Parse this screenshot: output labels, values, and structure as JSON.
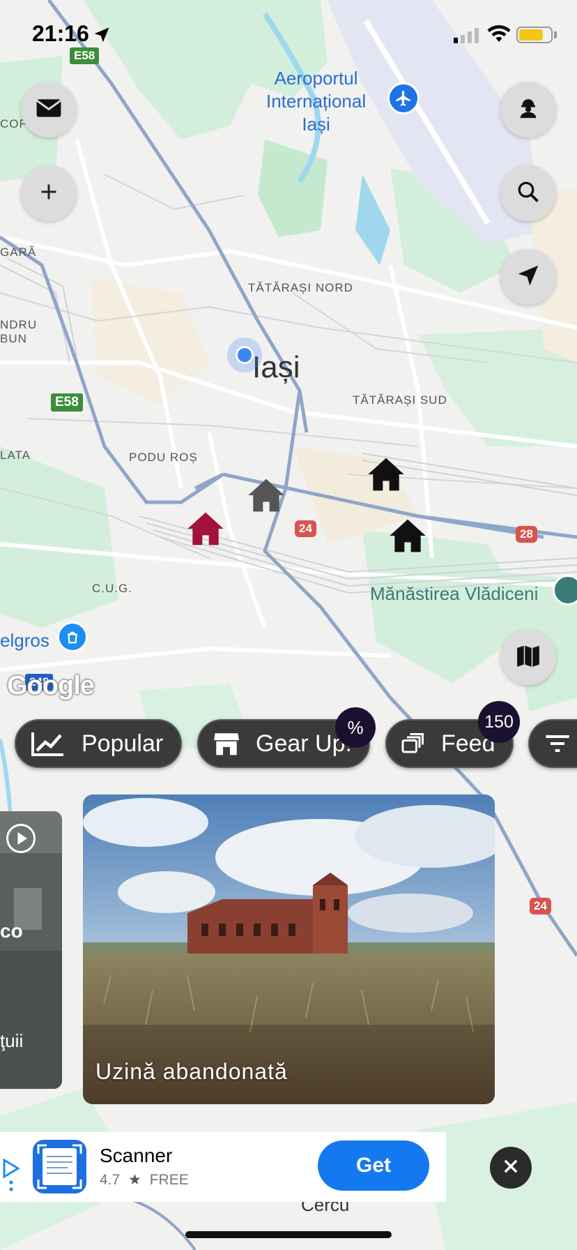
{
  "status_bar": {
    "time": "21:16"
  },
  "map": {
    "labels": {
      "airport": "Aeroportul\nInternațional\nIași",
      "tatarasi_nord": "TĂTĂRAȘI NORD",
      "city": "Iași",
      "tatarasi_sud": "TĂTĂRAȘI SUD",
      "podu_ros": "PODU ROȘ",
      "cug": "C.U.G.",
      "manastirea": "Mănăstirea Vlădiceni",
      "selgros": "elgros",
      "gara": "GARĂ",
      "ndru": "NDRU",
      "bun": "BUN",
      "lata": "LATA",
      "cor": "COF",
      "cercu": "Cercu"
    },
    "shields": {
      "e58_top": "E58",
      "e58_mid": "E58",
      "r24_a": "24",
      "r28": "28",
      "r24_b": "24",
      "dn_blue": "248"
    },
    "google_logo": "Google",
    "colors": {
      "house_highlight": "#a3123a",
      "house_dark": "#111111",
      "house_gray": "#555555",
      "road": "#8ea6c8",
      "park": "#c9ecd5",
      "water": "#9fd8ee"
    }
  },
  "buttons": {
    "mail": "mail-icon",
    "add": "plus-icon",
    "profile": "worker-icon",
    "search": "search-icon",
    "locate": "navigation-arrow-icon",
    "map_style": "map-icon"
  },
  "chips": [
    {
      "label": "Popular",
      "icon": "trending-icon"
    },
    {
      "label": "Gear Up!",
      "icon": "store-icon",
      "badge": "%"
    },
    {
      "label": "Feed",
      "icon": "gallery-icon",
      "badge": "150"
    },
    {
      "label": "",
      "icon": "filter-icon"
    }
  ],
  "cards": {
    "side_partial_text_a": "co",
    "side_partial_text_b": "ţuii",
    "main_title": "Uzină abandonată"
  },
  "ad": {
    "app_name": "Scanner",
    "rating": "4.7",
    "price": "FREE",
    "cta": "Get"
  }
}
